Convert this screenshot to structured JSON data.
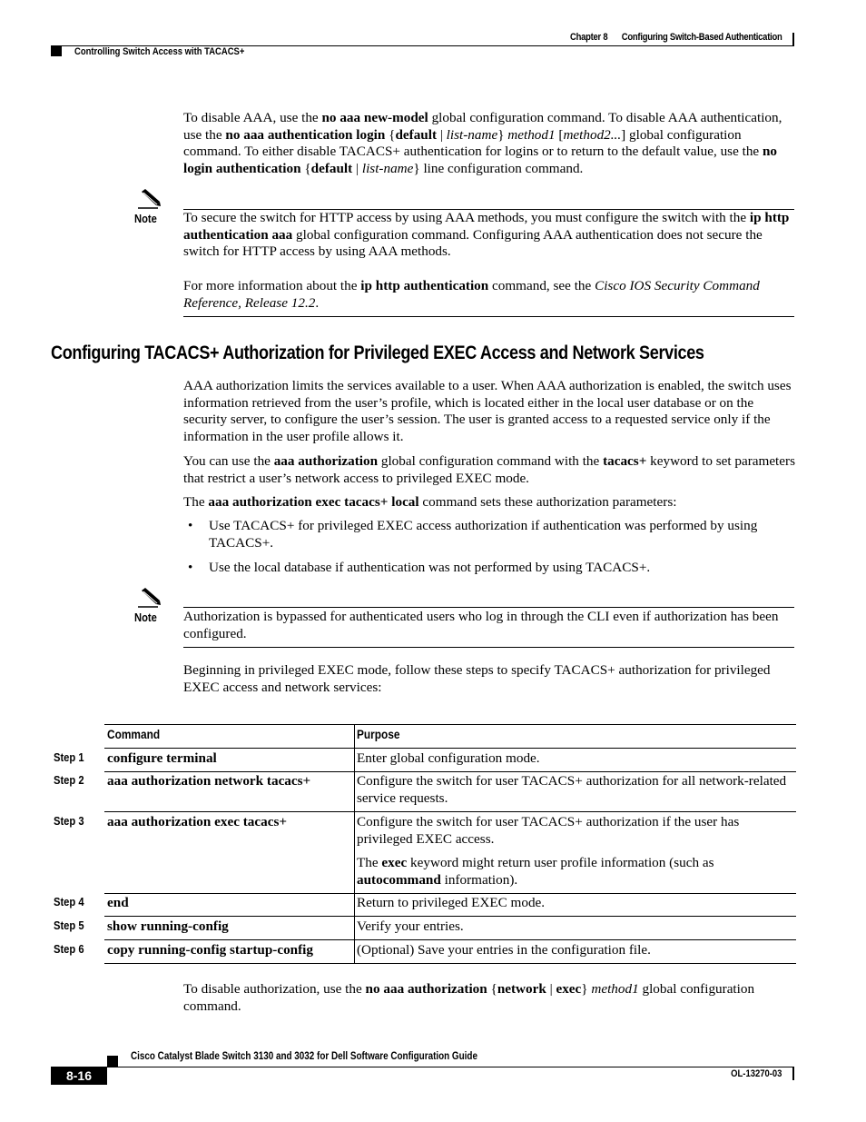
{
  "header": {
    "chapter": "Chapter 8",
    "chapter_title": "Configuring Switch-Based Authentication",
    "section": "Controlling Switch Access with TACACS+"
  },
  "intro_paragraph": {
    "t1": "To disable AAA, use the ",
    "b1": "no aaa new-model",
    "t2": " global configuration command. To disable AAA authentication, use the ",
    "b2": "no aaa authentication login",
    "t3": " {",
    "b3": "default",
    "t4": " | ",
    "i1": "list-name",
    "t5": "} ",
    "i2": "method1",
    "t6": " [",
    "i3": "method2...",
    "t7": "] global configuration command. To either disable TACACS+ authentication for logins or to return to the default value, use the ",
    "b4": "no login authentication",
    "t8": " {",
    "b5": "default",
    "t9": " | ",
    "i4": "list-name",
    "t10": "} line configuration command."
  },
  "note1": {
    "label": "Note",
    "icon": "pencil-note-icon",
    "p1": {
      "t1": "To secure the switch for HTTP access by using AAA methods, you must configure the switch with the ",
      "b1": "ip http authentication aaa",
      "t2": " global configuration command. Configuring AAA authentication does not secure the switch for HTTP access by using AAA methods."
    },
    "p2": {
      "t1": "For more information about the ",
      "b1": "ip http authentication",
      "t2": " command, see the ",
      "i1": "Cisco IOS Security Command Reference, Release 12.2",
      "t3": "."
    }
  },
  "section": {
    "heading": "Configuring TACACS+ Authorization for Privileged EXEC Access and Network Services",
    "p1": "AAA authorization limits the services available to a user. When AAA authorization is enabled, the switch uses information retrieved from the user’s profile, which is located either in the local user database or on the security server, to configure the user’s session. The user is granted access to a requested service only if the information in the user profile allows it.",
    "p2": {
      "t1": "You can use the ",
      "b1": "aaa authorization",
      "t2": " global configuration command with the ",
      "b2": "tacacs+",
      "t3": " keyword to set parameters that restrict a user’s network access to privileged EXEC mode."
    },
    "p3": {
      "t1": "The ",
      "b1": "aaa authorization exec tacacs+ local",
      "t2": " command sets these authorization parameters:"
    },
    "bullets": [
      "Use TACACS+ for privileged EXEC access authorization if authentication was performed by using TACACS+.",
      "Use the local database if authentication was not performed by using TACACS+."
    ],
    "bullet_glyph": "•"
  },
  "note2": {
    "label": "Note",
    "icon": "pencil-note-icon",
    "text": "Authorization is bypassed for authenticated users who log in through the CLI even if authorization has been configured."
  },
  "procedure_intro": "Beginning in privileged EXEC mode, follow these steps to specify TACACS+ authorization for privileged EXEC access and network services:",
  "table": {
    "headers": [
      "Command",
      "Purpose"
    ],
    "rows": [
      {
        "step": "Step 1",
        "command": "configure terminal",
        "purpose": "Enter global configuration mode."
      },
      {
        "step": "Step 2",
        "command": "aaa authorization network tacacs+",
        "purpose": "Configure the switch for user TACACS+ authorization for all network-related service requests."
      },
      {
        "step": "Step 3",
        "command": "aaa authorization exec tacacs+",
        "purpose": "Configure the switch for user TACACS+ authorization if the user has privileged EXEC access.",
        "purpose_extra": {
          "t1": "The ",
          "b1": "exec",
          "t2": " keyword might return user profile information (such as ",
          "b2": "autocommand",
          "t3": " information)."
        }
      },
      {
        "step": "Step 4",
        "command": "end",
        "purpose": "Return to privileged EXEC mode."
      },
      {
        "step": "Step 5",
        "command": "show running-config",
        "purpose": "Verify your entries."
      },
      {
        "step": "Step 6",
        "command": "copy running-config startup-config",
        "purpose": "(Optional) Save your entries in the configuration file."
      }
    ]
  },
  "closing_paragraph": {
    "t1": "To disable authorization, use the ",
    "b1": "no aaa authorization",
    "t2": " {",
    "b2": "network",
    "t3": " | ",
    "b3": "exec",
    "t4": "} ",
    "i1": "method1",
    "t5": " global configuration command."
  },
  "footer": {
    "guide_title": "Cisco Catalyst Blade Switch 3130 and 3032 for Dell Software Configuration Guide",
    "page_number": "8-16",
    "doc_number": "OL-13270-03"
  }
}
